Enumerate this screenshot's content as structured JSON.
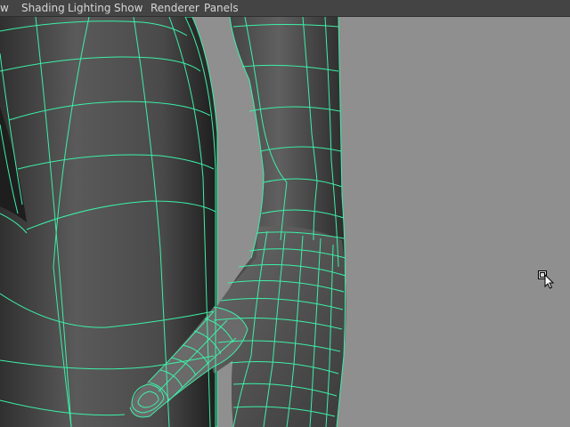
{
  "menubar": {
    "items": [
      {
        "label": "w"
      },
      {
        "label": "Shading"
      },
      {
        "label": "Lighting"
      },
      {
        "label": "Show"
      },
      {
        "label": "Renderer"
      },
      {
        "label": "Panels"
      }
    ]
  },
  "viewport": {
    "background_color": "#8f8f8f",
    "wireframe_color": "#3cf0a8",
    "mesh_shade_color": "#555555",
    "display_mode": "smooth-shaded-with-wireframe"
  },
  "icons": {
    "cursor": "arrow-with-box-cursor-icon"
  }
}
